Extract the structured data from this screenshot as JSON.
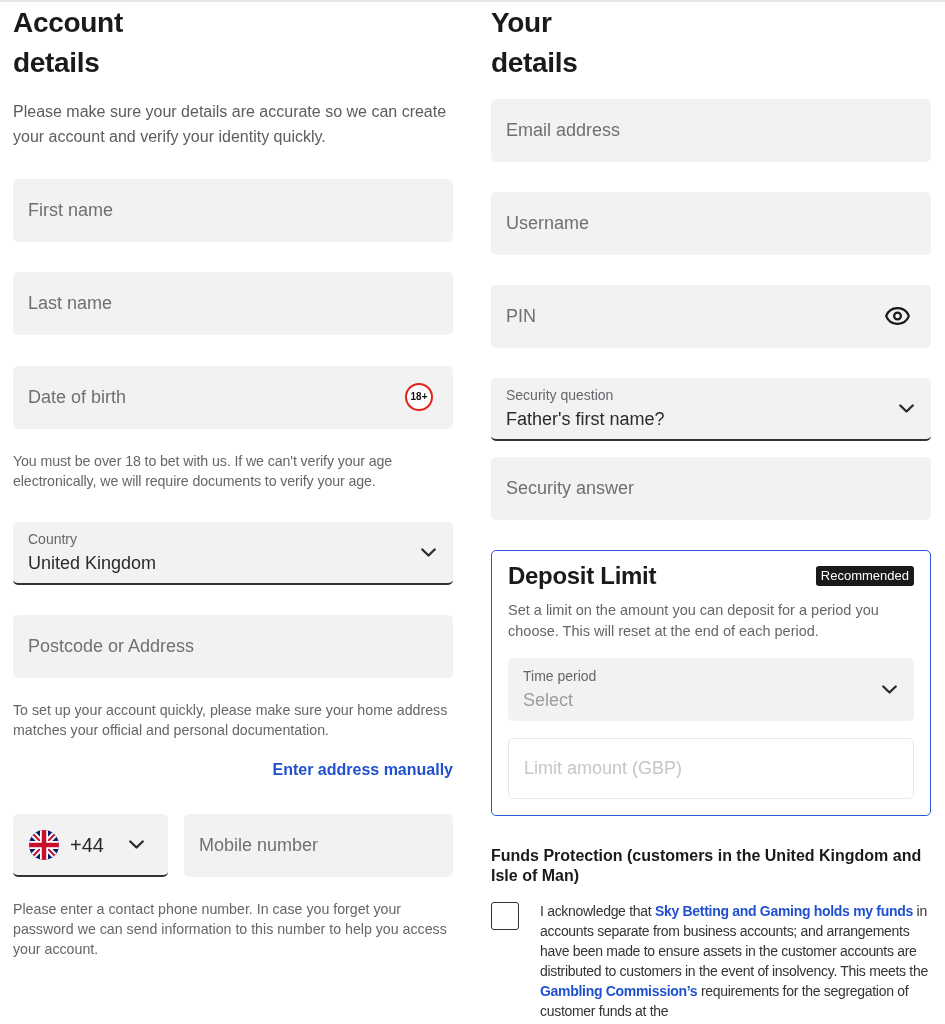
{
  "account_details": {
    "title": "Account details",
    "intro": "Please make sure your details are accurate so we can create your account and verify your identity quickly.",
    "first_name": {
      "placeholder": "First name"
    },
    "last_name": {
      "placeholder": "Last name"
    },
    "date_of_birth": {
      "placeholder": "Date of birth",
      "badge": "18+"
    },
    "age_note": "You must be over 18 to bet with us. If we can't verify your age electronically, we will require documents to verify your age.",
    "country": {
      "label": "Country",
      "value": "United Kingdom"
    },
    "address": {
      "placeholder": "Postcode or Address"
    },
    "address_note": "To set up your account quickly, please make sure your home address matches your official and personal documentation.",
    "manual_address_link": "Enter address manually",
    "phone": {
      "country_code": "+44",
      "placeholder": "Mobile number"
    },
    "phone_note": "Please enter a contact phone number. In case you forget your password we can send information to this number to help you access your account."
  },
  "your_details": {
    "title": "Your details",
    "email": {
      "placeholder": "Email address"
    },
    "username": {
      "placeholder": "Username"
    },
    "pin": {
      "placeholder": "PIN"
    },
    "security_question": {
      "label": "Security question",
      "value": "Father's first name?"
    },
    "security_answer": {
      "placeholder": "Security answer"
    }
  },
  "deposit_limit": {
    "title": "Deposit Limit",
    "badge": "Recommended",
    "description": "Set a limit on the amount you can deposit for a period you choose. This will reset at the end of each period.",
    "time_period": {
      "label": "Time period",
      "placeholder": "Select"
    },
    "limit_amount": {
      "placeholder": "Limit amount (GBP)",
      "disabled": true
    }
  },
  "funds_protection": {
    "title": "Funds Protection (customers in the United Kingdom and Isle of Man)",
    "acknowledgement": {
      "checked": false,
      "parts": [
        {
          "kind": "text",
          "text": "I acknowledge that "
        },
        {
          "kind": "link",
          "text": "Sky Betting and Gaming holds my funds"
        },
        {
          "kind": "text",
          "text": " in accounts separate from business accounts; and arrangements have been made to ensure assets in the customer accounts are distributed to customers in the event of insolvency. This meets the "
        },
        {
          "kind": "link",
          "text": "Gambling Commission’s"
        },
        {
          "kind": "text",
          "text": " requirements for the segregation of customer funds at the"
        }
      ]
    }
  }
}
